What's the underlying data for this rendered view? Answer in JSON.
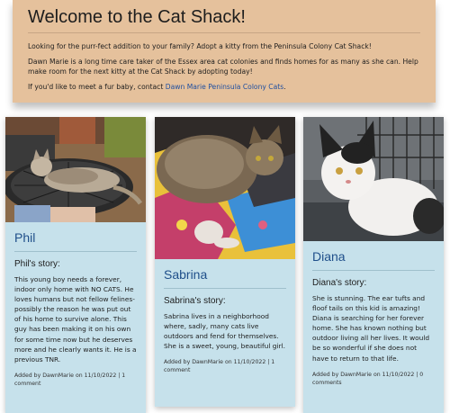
{
  "hero": {
    "title": "Welcome to the Cat Shack!",
    "intro": "Looking for the purr-fect addition to your family? Adopt a kitty from the Peninsula Colony Cat Shack!",
    "about": "Dawn Marie is a long time care taker of the Essex area cat colonies and finds homes for as many as she can. Help make room for the next kitty at the Cat Shack by adopting today!",
    "contact_prefix": "If you'd like to meet a fur baby, contact ",
    "contact_link": "Dawn Marie Peninsula Colony Cats",
    "contact_suffix": "."
  },
  "cats": [
    {
      "name": "Phil",
      "story_heading": "Phil's story:",
      "story": "This young boy needs a forever, indoor only home with NO CATS. He loves humans but not fellow felines-possibly the reason he was put out of his home to survive alone. This guy has been making it on his own for some time now but he deserves more and he clearly wants it. He is a previous TNR.",
      "meta": "Added by DawnMarie on 11/10/2022 | 1 comment"
    },
    {
      "name": "Sabrina",
      "story_heading": "Sabrina's story:",
      "story": "Sabrina lives in a neighborhood where, sadly, many cats live outdoors and fend for themselves. She is a sweet, young, beautiful girl.",
      "meta": "Added by DawnMarie on 11/10/2022 | 1 comment"
    },
    {
      "name": "Diana",
      "story_heading": "Diana's story:",
      "story": "She is stunning. The ear tufts and floof tails on this kid is amazing! Diana is searching for her forever home. She has known nothing but outdoor living all her lives. It would be so wonderful if she does not have to return to that life.",
      "meta": "Added by DawnMarie on 11/10/2022 | 0 comments"
    }
  ]
}
